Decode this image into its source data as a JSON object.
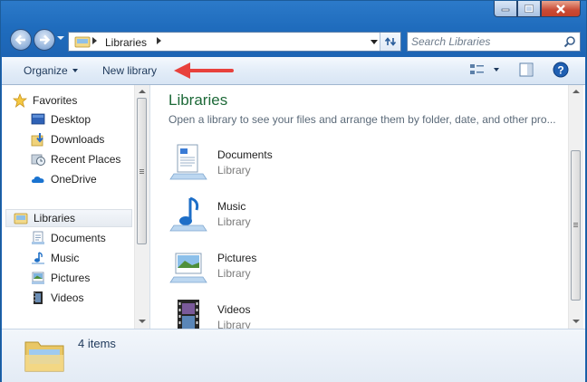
{
  "window": {
    "caption_buttons": [
      "minimize",
      "maximize",
      "close"
    ]
  },
  "navigation": {
    "back_icon": "back-arrow-icon",
    "forward_icon": "forward-arrow-icon"
  },
  "address_bar": {
    "breadcrumb": "Libraries",
    "icon": "libraries-folder-icon"
  },
  "search": {
    "placeholder": "Search Libraries",
    "icon": "search-icon"
  },
  "toolbar": {
    "organize_label": "Organize",
    "new_library_label": "New library",
    "annotation_arrow_color": "#e8413c"
  },
  "nav_pane": {
    "favorites_label": "Favorites",
    "favorites": [
      {
        "label": "Desktop",
        "icon": "desktop-icon"
      },
      {
        "label": "Downloads",
        "icon": "downloads-icon"
      },
      {
        "label": "Recent Places",
        "icon": "recent-places-icon"
      },
      {
        "label": "OneDrive",
        "icon": "onedrive-icon"
      }
    ],
    "libraries_label": "Libraries",
    "libraries": [
      {
        "label": "Documents",
        "icon": "documents-icon"
      },
      {
        "label": "Music",
        "icon": "music-icon"
      },
      {
        "label": "Pictures",
        "icon": "pictures-icon"
      },
      {
        "label": "Videos",
        "icon": "videos-icon"
      }
    ]
  },
  "content": {
    "title": "Libraries",
    "subtitle": "Open a library to see your files and arrange them by folder, date, and other pro...",
    "items": [
      {
        "name": "Documents",
        "kind": "Library"
      },
      {
        "name": "Music",
        "kind": "Library"
      },
      {
        "name": "Pictures",
        "kind": "Library"
      },
      {
        "name": "Videos",
        "kind": "Library"
      }
    ],
    "title_color": "#1e6a39"
  },
  "details_pane": {
    "item_count": "4 items"
  }
}
